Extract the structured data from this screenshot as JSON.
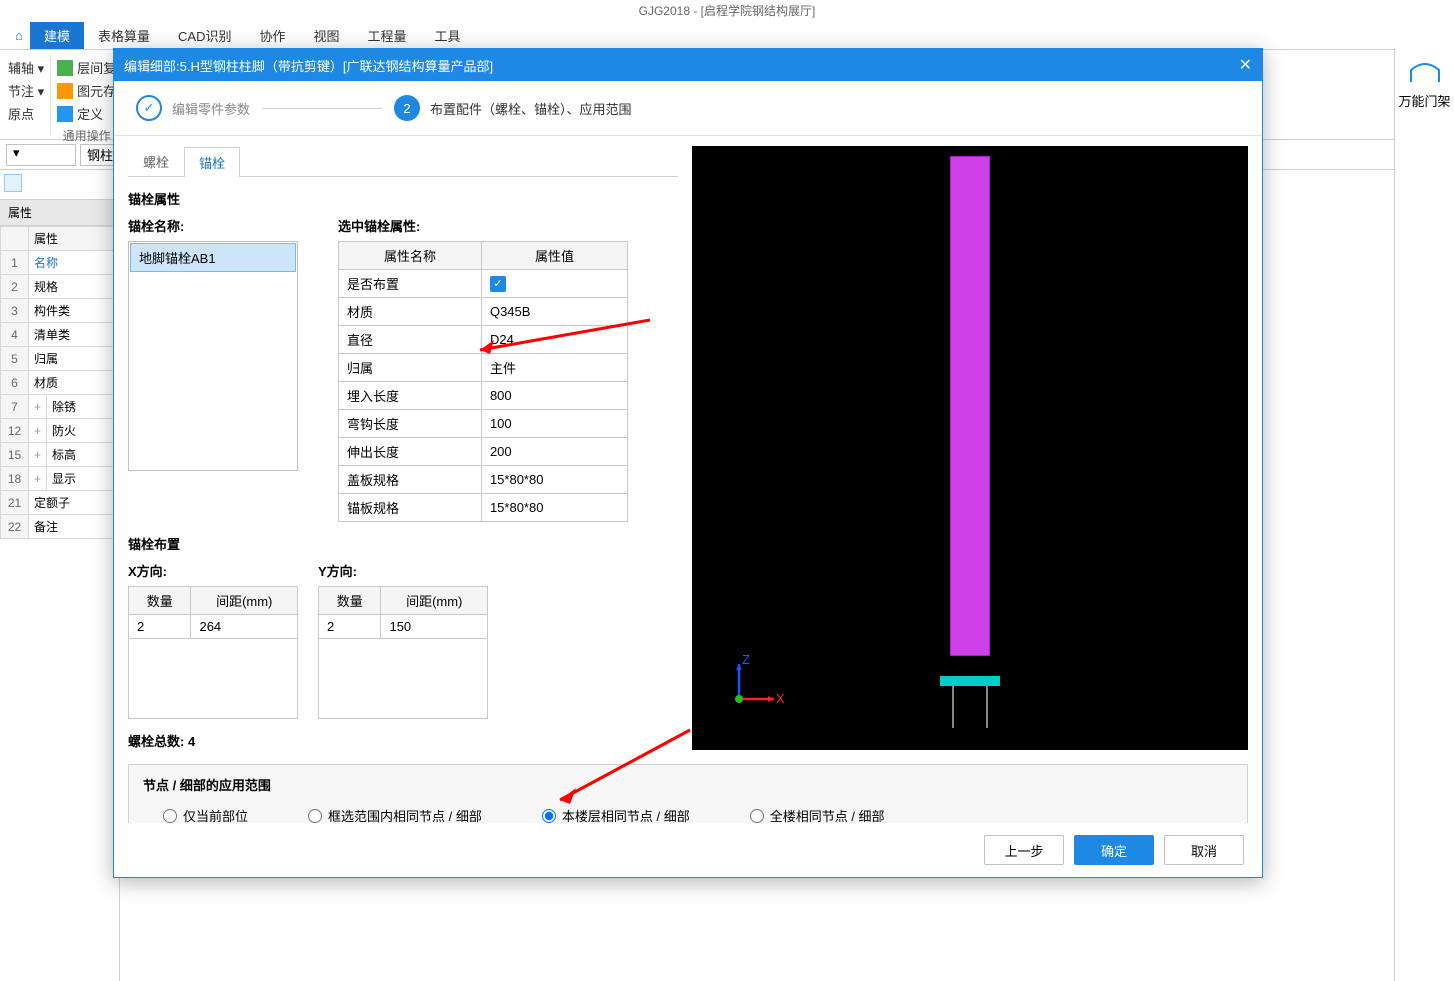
{
  "app": {
    "title": "GJG2018 - [启程学院钢结构展厅]"
  },
  "menu": {
    "home": "⌂",
    "tabs": [
      "建模",
      "表格算量",
      "CAD识别",
      "协作",
      "视图",
      "工程量",
      "工具"
    ],
    "active": 0
  },
  "ribbon": {
    "group1": {
      "a": "辅轴 ▾",
      "b": "节注 ▾",
      "c": "原点"
    },
    "group2": {
      "a": "层间复",
      "b": "图元存",
      "c": "定义"
    },
    "group_label": "通用操作"
  },
  "type_selector": {
    "arrow": "▾",
    "value": "钢柱"
  },
  "left_props": {
    "title": "属性",
    "col_header": "属性",
    "rows": [
      {
        "n": "1",
        "label": "名称",
        "link": true
      },
      {
        "n": "2",
        "label": "规格"
      },
      {
        "n": "3",
        "label": "构件类"
      },
      {
        "n": "4",
        "label": "清单类"
      },
      {
        "n": "5",
        "label": "归属"
      },
      {
        "n": "6",
        "label": "材质"
      },
      {
        "n": "7",
        "label": "除锈",
        "expand": "+"
      },
      {
        "n": "12",
        "label": "防火",
        "expand": "+"
      },
      {
        "n": "15",
        "label": "标高",
        "expand": "+"
      },
      {
        "n": "18",
        "label": "显示",
        "expand": "+"
      },
      {
        "n": "21",
        "label": "定额子"
      },
      {
        "n": "22",
        "label": "备注"
      }
    ]
  },
  "sidebar_right": {
    "label": "万能门架"
  },
  "dialog": {
    "title": "编辑细部:5.H型钢柱柱脚（带抗剪键）[广联达钢结构算量产品部]",
    "close": "✕",
    "steps": {
      "s1": {
        "badge": "✓",
        "label": "编辑零件参数"
      },
      "s2": {
        "badge": "2",
        "label": "布置配件（螺栓、锚栓）、应用范围"
      }
    },
    "tabs": {
      "bolt": "螺栓",
      "anchor": "锚栓"
    },
    "anchor_section": "锚栓属性",
    "anchor_name_label": "锚栓名称:",
    "anchor_selected_label": "选中锚栓属性:",
    "anchor_item": "地脚锚栓AB1",
    "attr_headers": {
      "name": "属性名称",
      "value": "属性值"
    },
    "attrs": [
      {
        "name": "是否布置",
        "value": "",
        "check": true
      },
      {
        "name": "材质",
        "value": "Q345B"
      },
      {
        "name": "直径",
        "value": "D24"
      },
      {
        "name": "归属",
        "value": "主件"
      },
      {
        "name": "埋入长度",
        "value": "800"
      },
      {
        "name": "弯钩长度",
        "value": "100"
      },
      {
        "name": "伸出长度",
        "value": "200"
      },
      {
        "name": "盖板规格",
        "value": "15*80*80"
      },
      {
        "name": "锚板规格",
        "value": "15*80*80"
      }
    ],
    "layout_section": "锚栓布置",
    "x_label": "X方向:",
    "y_label": "Y方向:",
    "xy_headers": {
      "count": "数量",
      "spacing": "间距(mm)"
    },
    "x_data": {
      "count": "2",
      "spacing": "264"
    },
    "y_data": {
      "count": "2",
      "spacing": "150"
    },
    "total_label": "螺栓总数:",
    "total_value": "4",
    "scope": {
      "title": "节点 / 细部的应用范围",
      "opts": [
        "仅当前部位",
        "框选范围内相同节点 / 细部",
        "本楼层相同节点 / 细部",
        "全楼相同节点 / 细部"
      ],
      "selected": 2
    },
    "footer": {
      "prev": "上一步",
      "ok": "确定",
      "cancel": "取消"
    }
  },
  "axis_labels": {
    "x": "X",
    "z": "Z"
  }
}
